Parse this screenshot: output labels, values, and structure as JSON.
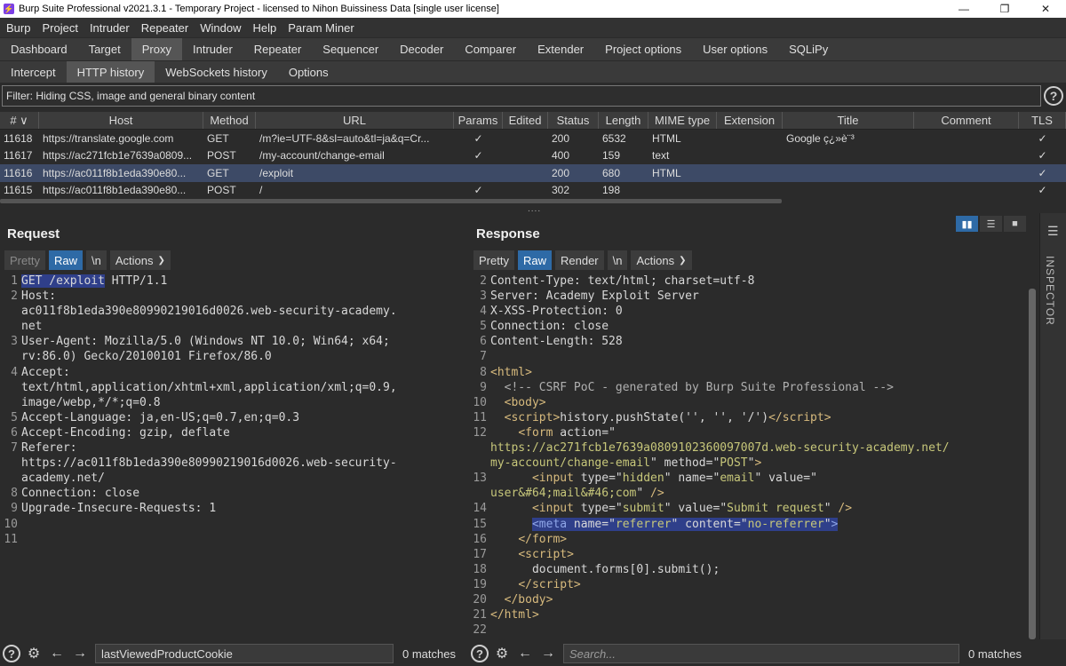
{
  "window": {
    "title": "Burp Suite Professional v2021.3.1 - Temporary Project - licensed to Nihon Buissiness Data [single user license]",
    "minimize": "—",
    "restore": "❐",
    "close": "✕"
  },
  "menu": [
    "Burp",
    "Project",
    "Intruder",
    "Repeater",
    "Window",
    "Help",
    "Param Miner"
  ],
  "main_tabs": [
    "Dashboard",
    "Target",
    "Proxy",
    "Intruder",
    "Repeater",
    "Sequencer",
    "Decoder",
    "Comparer",
    "Extender",
    "Project options",
    "User options",
    "SQLiPy"
  ],
  "main_tabs_active": "Proxy",
  "sub_tabs": [
    "Intercept",
    "HTTP history",
    "WebSockets history",
    "Options"
  ],
  "sub_tabs_active": "HTTP history",
  "filter": "Filter: Hiding CSS, image and general binary content",
  "table": {
    "headers": [
      "# ∨",
      "Host",
      "Method",
      "URL",
      "Params",
      "Edited",
      "Status",
      "Length",
      "MIME type",
      "Extension",
      "Title",
      "Comment",
      "TLS"
    ],
    "rows": [
      {
        "num": "11618",
        "host": "https://translate.google.com",
        "method": "GET",
        "url": "/m?ie=UTF-8&sl=auto&tl=ja&q=Cr...",
        "params": "✓",
        "edited": "",
        "status": "200",
        "length": "6532",
        "mime": "HTML",
        "ext": "",
        "title": "Google ç¿»è¨³",
        "comment": "",
        "tls": "✓"
      },
      {
        "num": "11617",
        "host": "https://ac271fcb1e7639a0809...",
        "method": "POST",
        "url": "/my-account/change-email",
        "params": "✓",
        "edited": "",
        "status": "400",
        "length": "159",
        "mime": "text",
        "ext": "",
        "title": "",
        "comment": "",
        "tls": "✓"
      },
      {
        "num": "11616",
        "host": "https://ac011f8b1eda390e80...",
        "method": "GET",
        "url": "/exploit",
        "params": "",
        "edited": "",
        "status": "200",
        "length": "680",
        "mime": "HTML",
        "ext": "",
        "title": "",
        "comment": "",
        "tls": "✓",
        "selected": true
      },
      {
        "num": "11615",
        "host": "https://ac011f8b1eda390e80...",
        "method": "POST",
        "url": "/",
        "params": "✓",
        "edited": "",
        "status": "302",
        "length": "198",
        "mime": "",
        "ext": "",
        "title": "",
        "comment": "",
        "tls": "✓"
      }
    ]
  },
  "divider": "....",
  "request": {
    "title": "Request",
    "toolbar": {
      "pretty": "Pretty",
      "raw": "Raw",
      "newline": "\\n",
      "actions": "Actions"
    },
    "search_value": "lastViewedProductCookie",
    "matches": "0 matches"
  },
  "response": {
    "title": "Response",
    "toolbar": {
      "pretty": "Pretty",
      "raw": "Raw",
      "render": "Render",
      "newline": "\\n",
      "actions": "Actions"
    },
    "search_placeholder": "Search...",
    "matches": "0 matches"
  },
  "inspector_label": "INSPECTOR",
  "colors": {
    "accent": "#2e6aa6",
    "selected_row": "#3d4a66",
    "highlight": "#2f3f8a"
  }
}
